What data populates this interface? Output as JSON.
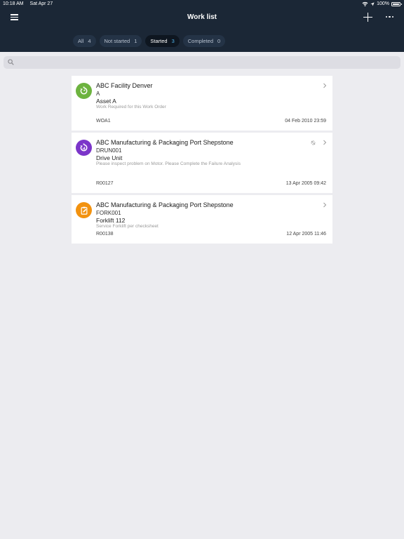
{
  "status_bar": {
    "time": "10:18 AM",
    "date": "Sat Apr 27",
    "battery": "100%"
  },
  "nav": {
    "title": "Work list"
  },
  "filters": [
    {
      "label": "All",
      "count": "4"
    },
    {
      "label": "Not started",
      "count": "1"
    },
    {
      "label": "Started",
      "count": "3"
    },
    {
      "label": "Completed",
      "count": "0"
    }
  ],
  "search": {
    "placeholder": ""
  },
  "work_orders": [
    {
      "site": "ABC Facility Denver",
      "code": "A",
      "asset": "Asset A",
      "description": "Work Required for this Work Order",
      "reference": "WOA1",
      "datetime": "04 Feb 2010 23:59",
      "color": "#6db33f"
    },
    {
      "site": "ABC Manufacturing & Packaging Port Shepstone",
      "code": "DRUN001",
      "asset": "Drive Unit",
      "description": "Please inspect problem on Motor.  Please Complete the Failure Analysis",
      "reference": "R00127",
      "datetime": "13 Apr 2005 09:42",
      "color": "#7b35c9"
    },
    {
      "site": "ABC Manufacturing & Packaging Port Shepstone",
      "code": "FORK001",
      "asset": "Forklift 112",
      "description": "Service Forklift per checksheet",
      "reference": "R00138",
      "datetime": "12 Apr 2005 11:46",
      "color": "#f2920f"
    }
  ]
}
